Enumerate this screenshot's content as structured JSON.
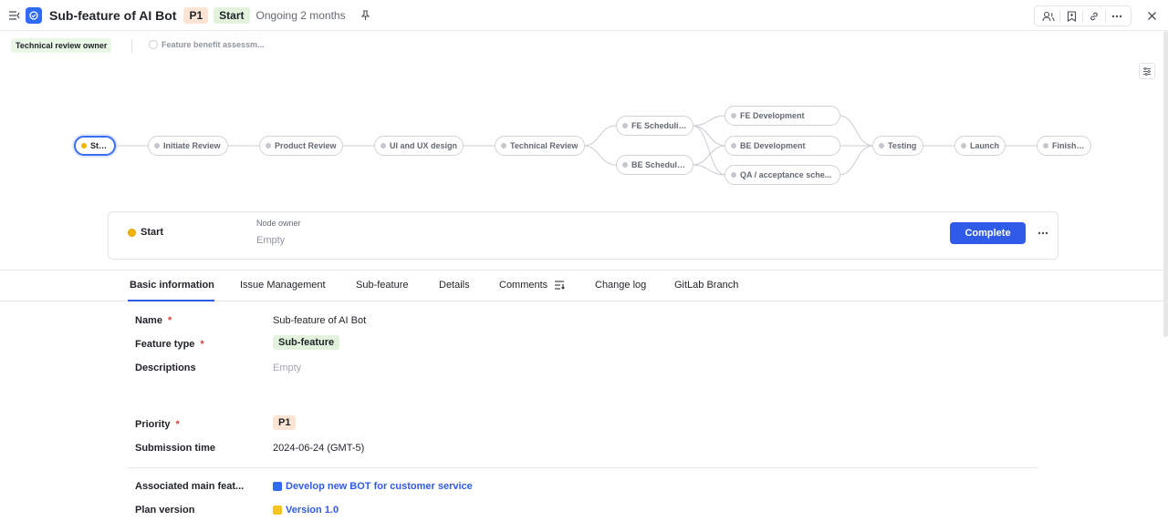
{
  "header": {
    "title": "Sub-feature of AI Bot",
    "priority_tag": "P1",
    "status_tag": "Start",
    "status_text": "Ongoing 2 months",
    "icons": [
      "sidebar-toggle-icon",
      "feature-app-icon",
      "pin-icon",
      "members-icon",
      "bookmark-icon",
      "link-icon",
      "more-icon",
      "close-icon"
    ]
  },
  "owner_bar": {
    "role_tag": "Technical review owner",
    "assessment_item": "Feature benefit assessm..."
  },
  "workflow": {
    "nodes": [
      {
        "id": "start",
        "label": "Start",
        "active": true
      },
      {
        "id": "initiate",
        "label": "Initiate Review"
      },
      {
        "id": "product",
        "label": "Product Review"
      },
      {
        "id": "uiux",
        "label": "UI and UX design"
      },
      {
        "id": "tech",
        "label": "Technical Review"
      },
      {
        "id": "fe_sched",
        "label": "FE Scheduling"
      },
      {
        "id": "be_sched",
        "label": "BE Scheduling"
      },
      {
        "id": "fe_dev",
        "label": "FE Development"
      },
      {
        "id": "be_dev",
        "label": "BE Development"
      },
      {
        "id": "qa",
        "label": "QA / acceptance sche..."
      },
      {
        "id": "testing",
        "label": "Testing"
      },
      {
        "id": "launch",
        "label": "Launch"
      },
      {
        "id": "finished",
        "label": "Finished"
      }
    ]
  },
  "node_card": {
    "node_name": "Start",
    "owner_label": "Node owner",
    "owner_value": "Empty",
    "complete_label": "Complete"
  },
  "tabs": [
    {
      "label": "Basic information",
      "active": true
    },
    {
      "label": "Issue Management"
    },
    {
      "label": "Sub-feature"
    },
    {
      "label": "Details"
    },
    {
      "label": "Comments"
    },
    {
      "label": "Change log"
    },
    {
      "label": "GitLab Branch"
    }
  ],
  "fields": {
    "name": {
      "label": "Name",
      "value": "Sub-feature of AI Bot",
      "required": "*"
    },
    "feature_type": {
      "label": "Feature type",
      "value": "Sub-feature",
      "required": "*"
    },
    "descriptions": {
      "label": "Descriptions",
      "value": "Empty"
    },
    "priority": {
      "label": "Priority",
      "value": "P1",
      "required": "*"
    },
    "submission_time": {
      "label": "Submission time",
      "value": "2024-06-24 (GMT-5)"
    },
    "associated_main": {
      "label": "Associated main feat...",
      "value": "Develop new BOT for customer service"
    },
    "plan_version": {
      "label": "Plan version",
      "value": "Version 1.0"
    }
  },
  "colors": {
    "accent": "#2f5be8",
    "active_dot": "#f5b400",
    "required": "#e03e3e"
  }
}
